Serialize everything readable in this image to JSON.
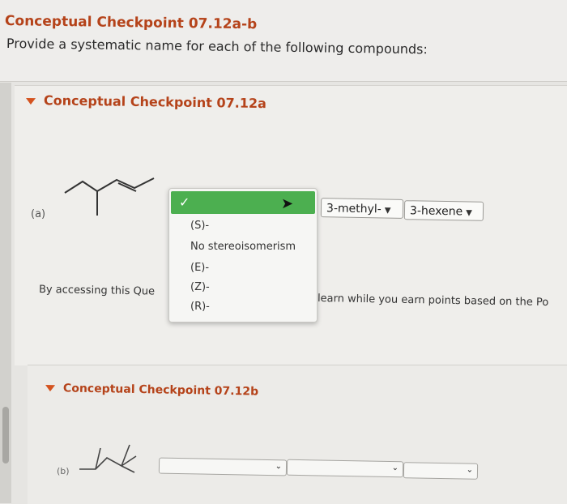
{
  "header": {
    "title": "Conceptual Checkpoint 07.12a-b",
    "subtitle": "Provide a systematic name for each of the following compounds:"
  },
  "section_a": {
    "title": "Conceptual Checkpoint 07.12a",
    "label": "(a)",
    "dropdown_methyl": "3-methyl-",
    "dropdown_hexene": "3-hexene",
    "text_left": "By accessing this Que",
    "text_right": "learn while you earn points based on the Po"
  },
  "popup": {
    "check": "✓",
    "options": [
      "(S)-",
      "No stereoisomerism",
      "(E)-",
      "(Z)-",
      "(R)-"
    ]
  },
  "section_b": {
    "title": "Conceptual Checkpoint 07.12b",
    "label": "(b)"
  },
  "icons": {
    "triangle": "caret-down-icon",
    "check": "check-icon",
    "cursor": "mouse-cursor-icon",
    "chevron": "chevron-down-icon"
  },
  "colors": {
    "accent": "#b5431a",
    "selected": "#4caf50"
  }
}
